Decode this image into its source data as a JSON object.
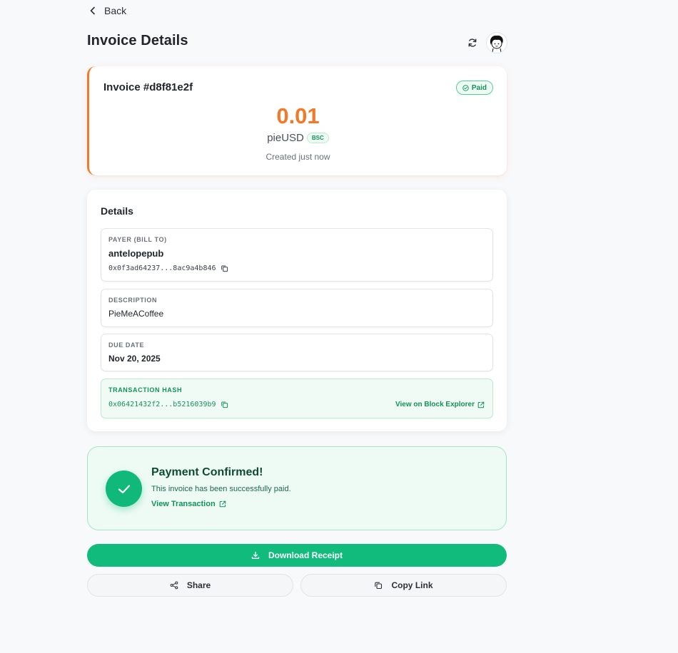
{
  "nav": {
    "back_label": "Back"
  },
  "header": {
    "title": "Invoice Details"
  },
  "invoice": {
    "number": "Invoice #d8f81e2f",
    "status": "Paid",
    "amount": "0.01",
    "currency": "pieUSD",
    "chain": "BSC",
    "created": "Created just now"
  },
  "details": {
    "title": "Details",
    "payer": {
      "label": "PAYER (BILL TO)",
      "name": "antelopepub",
      "address": "0x0f3ad64237...8ac9a4b846"
    },
    "description": {
      "label": "DESCRIPTION",
      "value": "PieMeACoffee"
    },
    "due_date": {
      "label": "DUE DATE",
      "value": "Nov 20, 2025"
    },
    "transaction": {
      "label": "TRANSACTION HASH",
      "hash": "0x06421432f2...b5216039b9",
      "explorer_label": "View on Block Explorer"
    }
  },
  "confirmation": {
    "title": "Payment Confirmed!",
    "message": "This invoice has been successfully paid.",
    "link_label": "View Transaction"
  },
  "actions": {
    "download_label": "Download Receipt",
    "share_label": "Share",
    "copy_link_label": "Copy Link"
  },
  "colors": {
    "accent_orange": "#f07a2a",
    "success_green": "#10bb7b",
    "text_dark": "#22262b"
  },
  "icons": {
    "back": "chevron-left-icon",
    "refresh": "refresh-icon",
    "paid": "check-circle-icon",
    "copy": "copy-icon",
    "external": "external-link-icon",
    "confirmed": "checkmark-icon",
    "download": "download-icon",
    "share": "share-icon",
    "copy_link": "copy-icon"
  }
}
